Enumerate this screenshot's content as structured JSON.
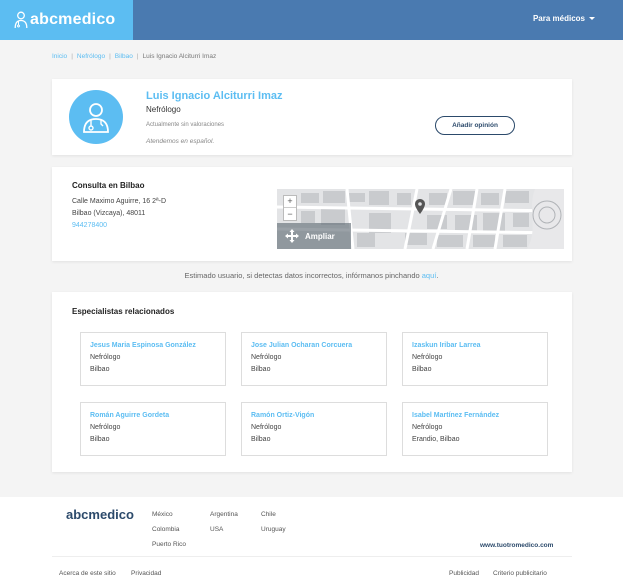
{
  "header": {
    "logo": "abcmedico",
    "menu_label": "Para médicos",
    "colors": {
      "bar": "#4a7ab0",
      "logo_bg": "#5cbdf2"
    }
  },
  "breadcrumb": {
    "items": [
      "Inicio",
      "Nefrólogo",
      "Bilbao"
    ],
    "current": "Luis Ignacio Alciturri Imaz",
    "separator": "|"
  },
  "profile": {
    "name": "Luis Ignacio Alciturri Imaz",
    "specialty": "Nefrólogo",
    "reviews": "Actualmente sin valoraciones",
    "language": "Atendemos en español.",
    "add_opinion": "Añadir opinión",
    "avatar_icon": "doctor-icon"
  },
  "consulta": {
    "title": "Consulta en Bilbao",
    "address_line1": "Calle Maximo Aguirre, 16 2ª-D",
    "address_line2": "Bilbao (Vizcaya), 48011",
    "phone": "944278400",
    "map": {
      "zoom_in": "+",
      "zoom_out": "−",
      "expand": "Ampliar"
    }
  },
  "notice": {
    "text": "Estimado usuario, si detectas datos incorrectos, infórmanos pinchando ",
    "link": "aquí",
    "end": "."
  },
  "related": {
    "title": "Especialistas relacionados",
    "items": [
      {
        "name": "Jesus Maria Espinosa González",
        "specialty": "Nefrólogo",
        "city": "Bilbao"
      },
      {
        "name": "Jose Julian Ocharan Corcuera",
        "specialty": "Nefrólogo",
        "city": "Bilbao"
      },
      {
        "name": "Izaskun Iribar Larrea",
        "specialty": "Nefrólogo",
        "city": "Bilbao"
      },
      {
        "name": "Román Aguirre Gordeta",
        "specialty": "Nefrólogo",
        "city": "Bilbao"
      },
      {
        "name": "Ramón Ortiz-Vigón",
        "specialty": "Nefrólogo",
        "city": "Bilbao"
      },
      {
        "name": "Isabel Martínez Fernández",
        "specialty": "Nefrólogo",
        "city": "Erandio, Bilbao"
      }
    ]
  },
  "footer": {
    "logo": "abcmedico",
    "countries": [
      "México",
      "Colombia",
      "Puerto Rico",
      "Argentina",
      "USA",
      "Chile",
      "Uruguay"
    ],
    "domain": "www.tuotromedico.com",
    "left_links": [
      "Acerca de este sitio",
      "Privacidad"
    ],
    "right_links": [
      "Publicidad",
      "Criterio publicitario"
    ]
  }
}
